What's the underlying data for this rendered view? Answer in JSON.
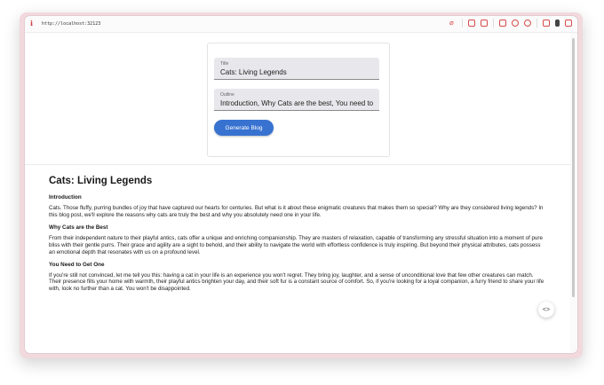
{
  "browser": {
    "url": "http://localhost:32123"
  },
  "form": {
    "title_label": "Title",
    "title_value": "Cats: Living Legends",
    "outline_label": "Outline",
    "outline_value": "Introduction, Why Cats are the best, You need to",
    "generate_button": "Generate Blog"
  },
  "article": {
    "title": "Cats: Living Legends",
    "sections": [
      {
        "heading": "Introduction",
        "body": "Cats. Those fluffy, purring bundles of joy that have captured our hearts for centuries. But what is it about these enigmatic creatures that makes them so special? Why are they considered living legends? In this blog post, we'll explore the reasons why cats are truly the best and why you absolutely need one in your life."
      },
      {
        "heading": "Why Cats are the Best",
        "body": "From their independent nature to their playful antics, cats offer a unique and enriching companionship. They are masters of relaxation, capable of transforming any stressful situation into a moment of pure bliss with their gentle purrs. Their grace and agility are a sight to behold, and their ability to navigate the world with effortless confidence is truly inspiring. But beyond their physical attributes, cats possess an emotional depth that resonates with us on a profound level."
      },
      {
        "heading": "You Need to Get One",
        "body": "If you're still not convinced, let me tell you this: having a cat in your life is an experience you won't regret. They bring joy, laughter, and a sense of unconditional love that few other creatures can match. Their presence fills your home with warmth, their playful antics brighten your day, and their soft fur is a constant source of comfort. So, if you're looking for a loyal companion, a furry friend to share your life with, look no further than a cat. You won't be disappointed."
      }
    ]
  },
  "fab": {
    "glyph": "<>"
  },
  "colors": {
    "accent": "#3872d1",
    "frame": "#f1d9de"
  },
  "icons": [
    "info-icon",
    "attach-icon",
    "record-icon",
    "camera-icon",
    "window-icon",
    "settings-icon",
    "location-icon",
    "code-icon",
    "battery-icon",
    "panel-icon",
    "code-toggle-icon"
  ]
}
